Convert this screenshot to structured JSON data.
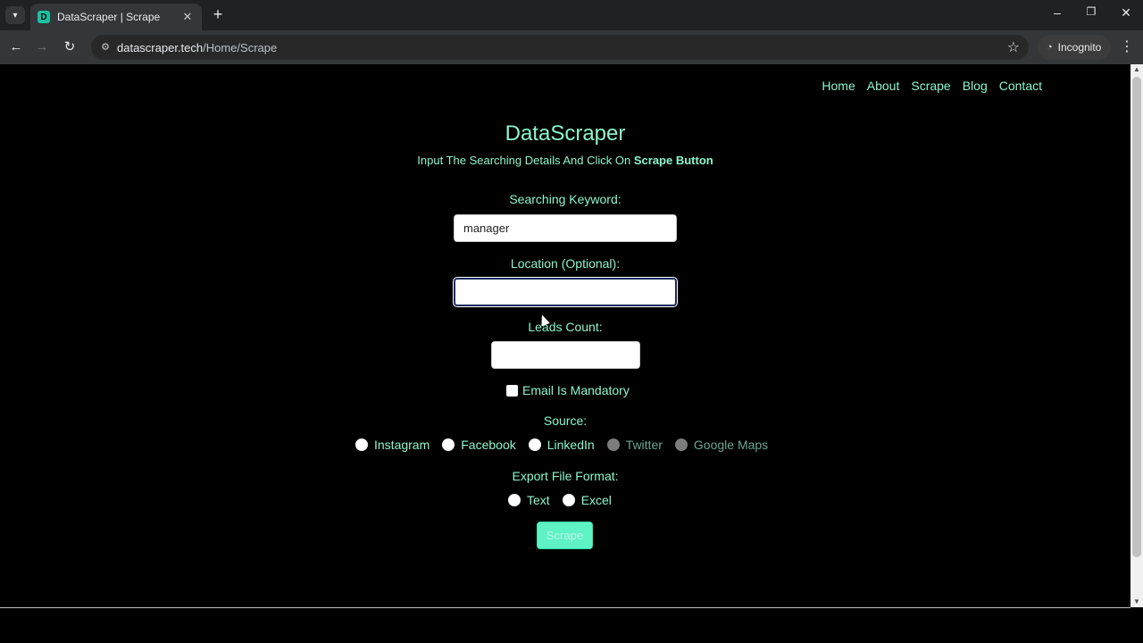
{
  "browser": {
    "tab_title": "DataScraper | Scrape",
    "tab_favicon_letter": "D",
    "url_host": "datascraper.tech",
    "url_path": "/Home/Scrape",
    "incognito_label": "Incognito"
  },
  "nav": {
    "items": [
      "Home",
      "About",
      "Scrape",
      "Blog",
      "Contact"
    ]
  },
  "header": {
    "title": "DataScraper",
    "subtitle_prefix": "Input The Searching Details And Click On ",
    "subtitle_bold": "Scrape Button"
  },
  "form": {
    "keyword_label": "Searching Keyword:",
    "keyword_value": "manager",
    "location_label": "Location (Optional):",
    "location_value": "",
    "leads_label": "Leads Count:",
    "leads_value": "",
    "email_mandatory_label": "Email Is Mandatory",
    "source_label": "Source:",
    "sources": [
      "Instagram",
      "Facebook",
      "LinkedIn",
      "Twitter",
      "Google Maps"
    ],
    "disabled_sources": [
      "Twitter",
      "Google Maps"
    ],
    "format_label": "Export File Format:",
    "formats": [
      "Text",
      "Excel"
    ],
    "submit_label": "Scrape"
  },
  "colors": {
    "accent": "#8cf5cc",
    "button": "#5ff2c4",
    "background": "#000000"
  }
}
